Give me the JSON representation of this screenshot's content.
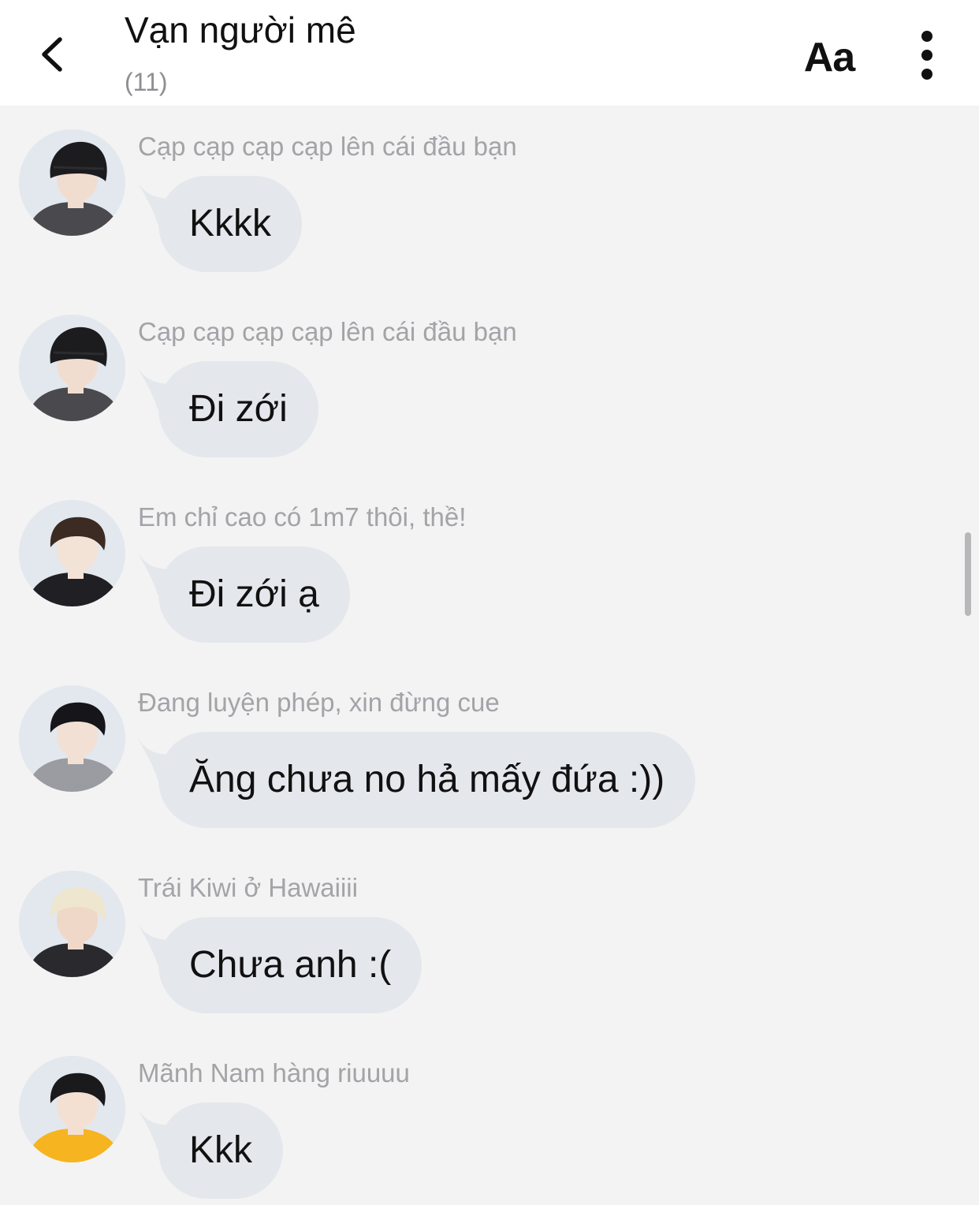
{
  "header": {
    "title": "Vạn người mê",
    "member_count": "(11)",
    "text_size_label": "Aa",
    "back_icon": "chevron-left-icon",
    "more_icon": "more-vertical-icon"
  },
  "messages": [
    {
      "sender": "Cạp cạp cạp cạp lên cái đầu bạn",
      "text": "Kkkk",
      "avatar": {
        "hair": "#1c1c1f",
        "hat": true,
        "shirt": "#4a4a4e",
        "skin": "#f1ddd0"
      }
    },
    {
      "sender": "Cạp cạp cạp cạp lên cái đầu bạn",
      "text": "Đi zới",
      "avatar": {
        "hair": "#1c1c1f",
        "hat": true,
        "shirt": "#4a4a4e",
        "skin": "#f1ddd0"
      }
    },
    {
      "sender": "Em chỉ cao có 1m7 thôi, thề!",
      "text": "Đi zới ạ",
      "avatar": {
        "hair": "#3b2b22",
        "hat": false,
        "shirt": "#202024",
        "skin": "#f3e2d6"
      }
    },
    {
      "sender": "Đang luyện phép, xin đừng cue",
      "text": "Ăng chưa no hả mấy đứa :))",
      "avatar": {
        "hair": "#15151a",
        "hat": false,
        "shirt": "#9b9ba2",
        "skin": "#f2e0d4"
      }
    },
    {
      "sender": "Trái Kiwi ở Hawaiiii",
      "text": "Chưa anh :(",
      "avatar": {
        "hair": "#eee6cf",
        "hat": false,
        "shirt": "#2a2a2e",
        "skin": "#f0d8c8"
      }
    },
    {
      "sender": "Mãnh Nam hàng riuuuu",
      "text": "Kkk",
      "avatar": {
        "hair": "#1a1a1d",
        "hat": false,
        "shirt": "#f7b421",
        "skin": "#f3e0d2"
      }
    }
  ],
  "colors": {
    "background": "#f3f3f3",
    "header_background": "#ffffff",
    "bubble": "#e4e7ec",
    "sender_text": "#a3a3a8",
    "message_text": "#111111"
  }
}
